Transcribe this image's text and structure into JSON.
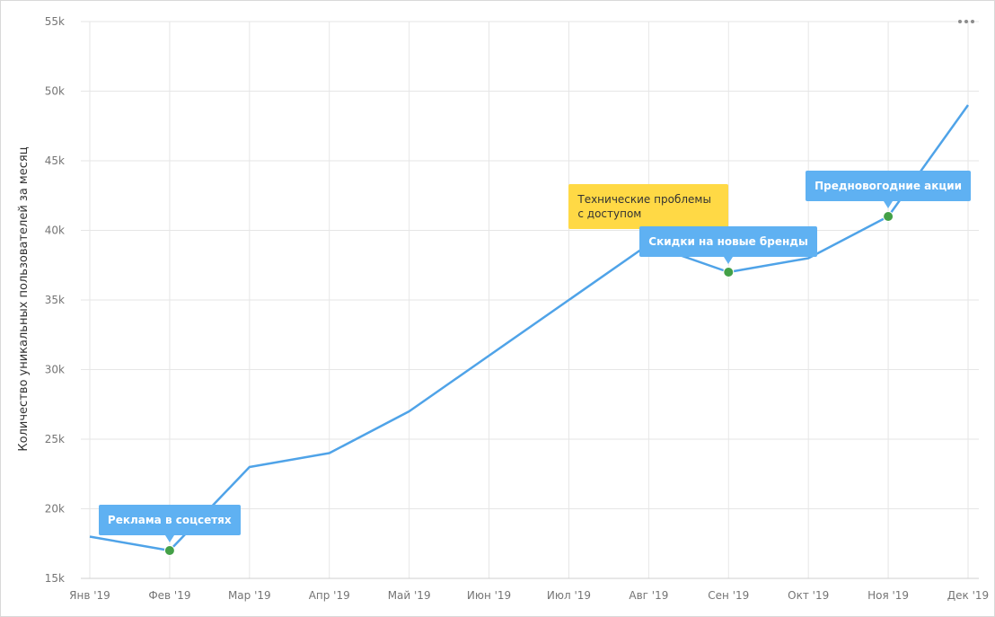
{
  "chart_data": {
    "type": "line",
    "categories": [
      "Янв '19",
      "Фев '19",
      "Мар '19",
      "Апр '19",
      "Май '19",
      "Июн '19",
      "Июл '19",
      "Авг '19",
      "Сен '19",
      "Окт '19",
      "Ноя '19",
      "Дек '19"
    ],
    "series": [
      {
        "values": [
          18000,
          17000,
          23000,
          24000,
          27000,
          31000,
          35000,
          39000,
          37000,
          38000,
          41000,
          49000
        ],
        "color": "#4fa3e8"
      }
    ],
    "ylabel": "Количество уникальных пользователей за месяц",
    "xlabel": "",
    "ylim": [
      15000,
      55000
    ],
    "yticks": [
      "15k",
      "20k",
      "25k",
      "30k",
      "35k",
      "40k",
      "45k",
      "50k",
      "55k"
    ],
    "grid": true,
    "annotations": [
      {
        "category_index": 1,
        "text": "Реклама в соцсетях",
        "style": "blue",
        "marker_color": "#43a047"
      },
      {
        "category_index": 7,
        "text": "Технические проблемы с доступом",
        "style": "yellow",
        "marker_color": "#f44336"
      },
      {
        "category_index": 8,
        "text": "Скидки на новые бренды",
        "style": "blue",
        "marker_color": "#43a047"
      },
      {
        "category_index": 10,
        "text": "Предновогодние акции",
        "style": "blue",
        "marker_color": "#43a047"
      }
    ]
  },
  "menu_icon": "more-horizontal-icon"
}
